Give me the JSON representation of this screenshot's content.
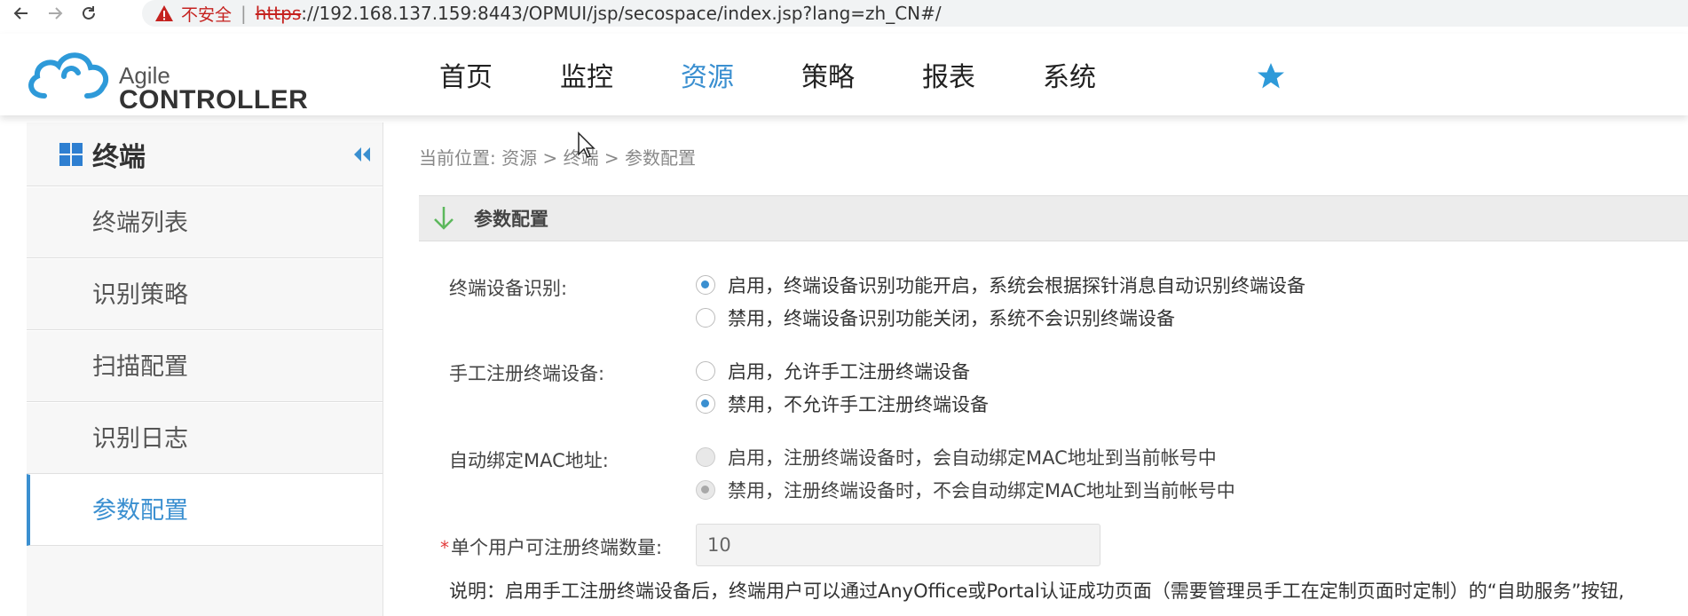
{
  "browser": {
    "insecure_label": "不安全",
    "separator": "|",
    "url_scheme": "https",
    "url_rest": "://192.168.137.159:8443/OPMUI/jsp/secospace/index.jsp?lang=zh_CN#/"
  },
  "header": {
    "logo_line1": "Agile",
    "logo_line2": "CONTROLLER",
    "nav": [
      "首页",
      "监控",
      "资源",
      "策略",
      "报表",
      "系统"
    ],
    "active_nav": "资源"
  },
  "sidebar": {
    "title": "终端",
    "items": [
      {
        "label": "终端列表"
      },
      {
        "label": "识别策略"
      },
      {
        "label": "扫描配置"
      },
      {
        "label": "识别日志"
      },
      {
        "label": "参数配置",
        "active": true
      }
    ]
  },
  "content": {
    "breadcrumb": "当前位置: 资源 > 终端 > 参数配置",
    "panel_title": "参数配置",
    "form": {
      "device_recognition": {
        "label": "终端设备识别:",
        "enable": "启用，终端设备识别功能开启，系统会根据探针消息自动识别终端设备",
        "disable": "禁用，终端设备识别功能关闭，系统不会识别终端设备",
        "selected": "enable"
      },
      "manual_register": {
        "label": "手工注册终端设备:",
        "enable": "启用，允许手工注册终端设备",
        "disable": "禁用，不允许手工注册终端设备",
        "selected": "disable"
      },
      "auto_bind_mac": {
        "label": "自动绑定MAC地址:",
        "enable": "启用，注册终端设备时，会自动绑定MAC地址到当前帐号中",
        "disable": "禁用，注册终端设备时，不会自动绑定MAC地址到当前帐号中",
        "selected": "disable",
        "disabled": true
      },
      "max_devices": {
        "required_mark": "*",
        "label": "单个用户可注册终端数量:",
        "value": "10"
      },
      "note": "说明：启用手工注册终端设备后，终端用户可以通过AnyOffice或Portal认证成功页面（需要管理员手工在定制页面时定制）的“自助服务”按钮,"
    }
  },
  "colors": {
    "accent": "#3a8fd0",
    "warning": "#c5221f",
    "required": "#e23b3b",
    "check_green": "#5cb85c"
  }
}
